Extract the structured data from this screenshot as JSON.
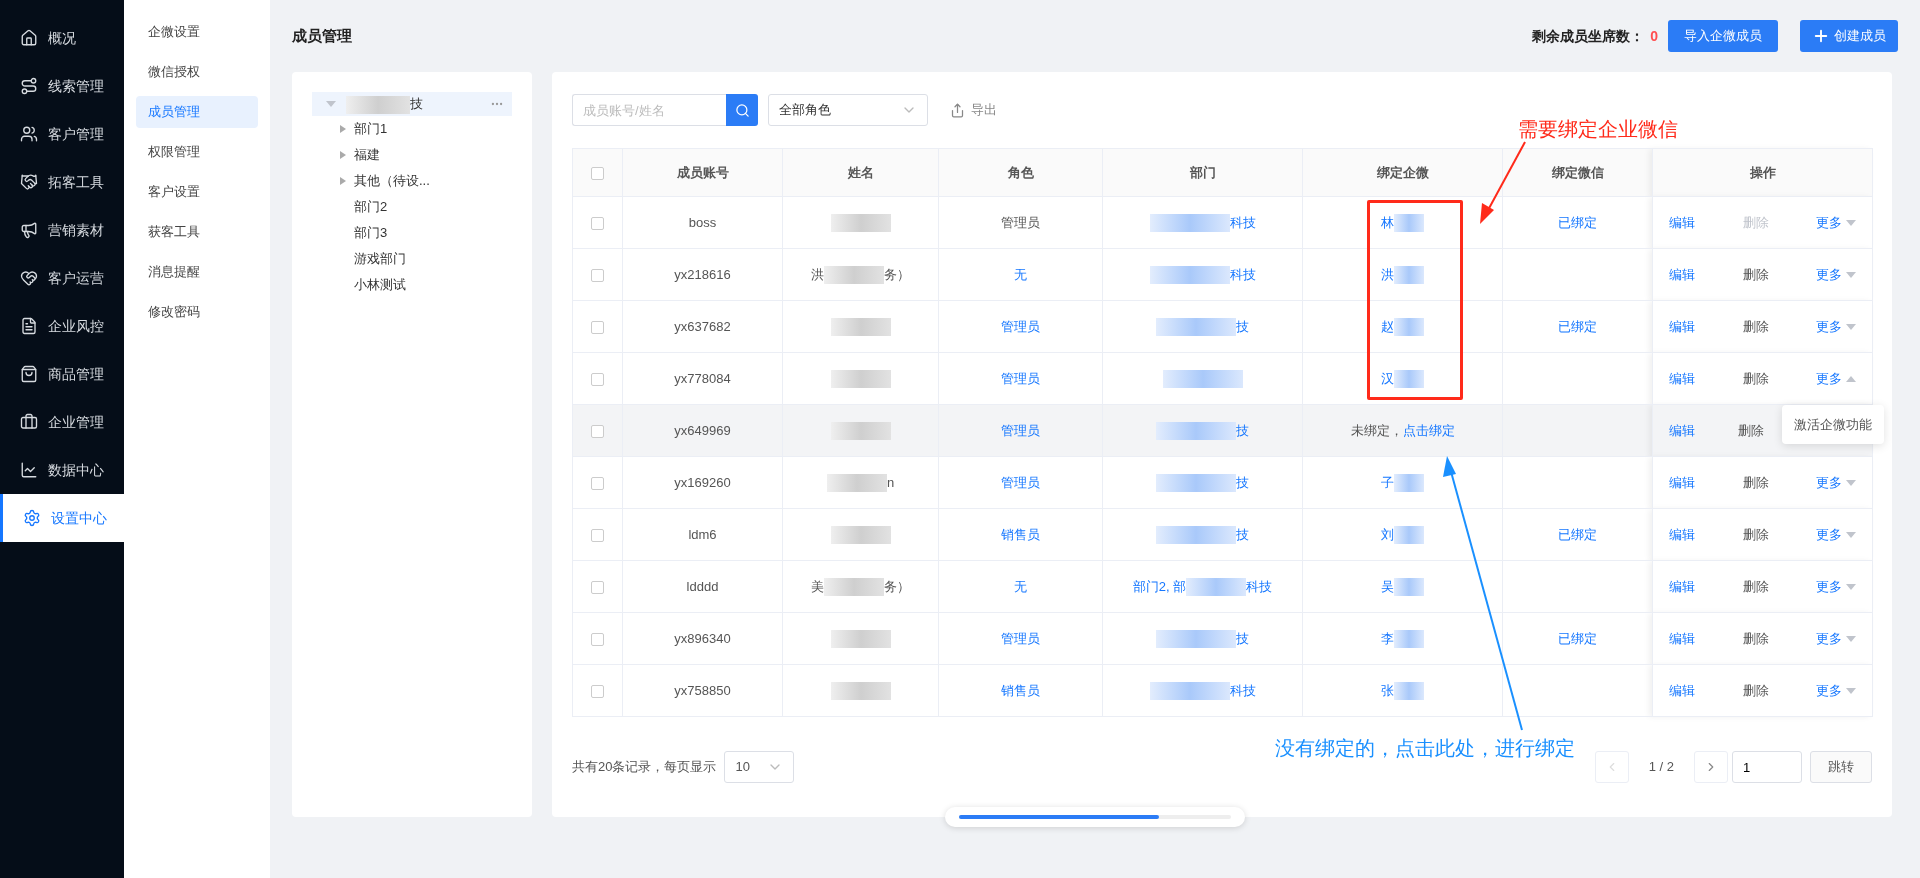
{
  "sidebar": {
    "items": [
      {
        "label": "概况",
        "selected": false
      },
      {
        "label": "线索管理",
        "selected": false
      },
      {
        "label": "客户管理",
        "selected": false
      },
      {
        "label": "拓客工具",
        "selected": false
      },
      {
        "label": "营销素材",
        "selected": false
      },
      {
        "label": "客户运营",
        "selected": false
      },
      {
        "label": "企业风控",
        "selected": false
      },
      {
        "label": "商品管理",
        "selected": false
      },
      {
        "label": "企业管理",
        "selected": false
      },
      {
        "label": "数据中心",
        "selected": false
      },
      {
        "label": "设置中心",
        "selected": true
      }
    ]
  },
  "submenu": {
    "items": [
      {
        "label": "企微设置",
        "selected": false
      },
      {
        "label": "微信授权",
        "selected": false
      },
      {
        "label": "成员管理",
        "selected": true
      },
      {
        "label": "权限管理",
        "selected": false
      },
      {
        "label": "客户设置",
        "selected": false
      },
      {
        "label": "获客工具",
        "selected": false
      },
      {
        "label": "消息提醒",
        "selected": false
      },
      {
        "label": "修改密码",
        "selected": false
      }
    ]
  },
  "page": {
    "title": "成员管理",
    "seats_label": "剩余成员坐席数：",
    "seats_value": "0",
    "import_button": "导入企微成员",
    "create_button": "创建成员"
  },
  "tree": {
    "root": {
      "label": "技",
      "expanded": true,
      "selected": true,
      "children": [
        {
          "label": "部门1",
          "expandable": true
        },
        {
          "label": "福建",
          "expandable": true
        },
        {
          "label": "其他（待设...",
          "expandable": true
        },
        {
          "label": "部门2",
          "expandable": false
        },
        {
          "label": "部门3",
          "expandable": false
        },
        {
          "label": "游戏部门",
          "expandable": false
        },
        {
          "label": "小林测试",
          "expandable": false
        }
      ]
    }
  },
  "toolbar": {
    "search": {
      "placeholder": "成员账号/姓名"
    },
    "role_select": "全部角色",
    "export": "导出"
  },
  "table": {
    "select_all_checked": false,
    "columns": [
      "成员账号",
      "姓名",
      "角色",
      "部门",
      "绑定企微",
      "绑定微信",
      "操作"
    ],
    "rows": [
      {
        "checked": false,
        "highlighted": false,
        "account": "boss",
        "name": {},
        "role": {
          "text": "管理员",
          "kind": "plain"
        },
        "dept": {
          "end": "科技"
        },
        "wecom": {
          "kind": "bound",
          "text": "林"
        },
        "wechat": "已绑定",
        "edit": "编辑",
        "delete": {
          "label": "删除",
          "disabled": true
        },
        "more": {
          "label": "更多",
          "expanded": false
        }
      },
      {
        "checked": false,
        "highlighted": false,
        "account": "yx218616",
        "name": {
          "start": "洪",
          "end": "务）"
        },
        "role": {
          "text": "无",
          "kind": "link"
        },
        "dept": {
          "end": "科技"
        },
        "wecom": {
          "kind": "bound",
          "text": "洪"
        },
        "edit": "编辑",
        "delete": {
          "label": "删除",
          "disabled": false
        },
        "more": {
          "label": "更多",
          "expanded": false
        }
      },
      {
        "checked": false,
        "highlighted": false,
        "account": "yx637682",
        "name": {},
        "role": {
          "text": "管理员",
          "kind": "link"
        },
        "dept": {
          "end": "技"
        },
        "wecom": {
          "kind": "bound",
          "text": "赵"
        },
        "wechat": "已绑定",
        "edit": "编辑",
        "delete": {
          "label": "删除",
          "disabled": false
        },
        "more": {
          "label": "更多",
          "expanded": false
        }
      },
      {
        "checked": false,
        "highlighted": false,
        "account": "yx778084",
        "name": {},
        "role": {
          "text": "管理员",
          "kind": "link"
        },
        "dept": {},
        "wecom": {
          "kind": "bound",
          "text": "汉"
        },
        "edit": "编辑",
        "delete": {
          "label": "删除",
          "disabled": false
        },
        "more": {
          "label": "更多",
          "expanded": true,
          "menu": [
            "激活企微功能"
          ]
        }
      },
      {
        "checked": false,
        "highlighted": true,
        "account": "yx649969",
        "name": {},
        "role": {
          "text": "管理员",
          "kind": "link"
        },
        "dept": {
          "end": "技"
        },
        "wecom": {
          "kind": "unbound",
          "text": "未绑定，",
          "link": "点击绑定"
        },
        "edit": "编辑",
        "delete": {
          "label": "删除",
          "disabled": false
        }
      },
      {
        "checked": false,
        "highlighted": false,
        "account": "yx169260",
        "name": {
          "end": "n"
        },
        "role": {
          "text": "管理员",
          "kind": "link"
        },
        "dept": {
          "end": "技"
        },
        "wecom": {
          "kind": "bound",
          "text": "子"
        },
        "edit": "编辑",
        "delete": {
          "label": "删除",
          "disabled": false
        },
        "more": {
          "label": "更多",
          "expanded": false
        }
      },
      {
        "checked": false,
        "highlighted": false,
        "account": "ldm6",
        "name": {},
        "role": {
          "text": "销售员",
          "kind": "link"
        },
        "dept": {
          "end": "技"
        },
        "wecom": {
          "kind": "bound",
          "text": "刘"
        },
        "wechat": "已绑定",
        "edit": "编辑",
        "delete": {
          "label": "删除",
          "disabled": false
        },
        "more": {
          "label": "更多",
          "expanded": false
        }
      },
      {
        "checked": false,
        "highlighted": false,
        "account": "ldddd",
        "name": {
          "start": "美",
          "end": "务）"
        },
        "role": {
          "text": "无",
          "kind": "link"
        },
        "dept": {
          "start": "部门2, 部",
          "end": "科技"
        },
        "wecom": {
          "kind": "bound",
          "text": "吴"
        },
        "edit": "编辑",
        "delete": {
          "label": "删除",
          "disabled": false
        },
        "more": {
          "label": "更多",
          "expanded": false
        }
      },
      {
        "checked": false,
        "highlighted": false,
        "account": "yx896340",
        "name": {},
        "role": {
          "text": "管理员",
          "kind": "link"
        },
        "dept": {
          "end": "技"
        },
        "wecom": {
          "kind": "bound",
          "text": "李"
        },
        "wechat": "已绑定",
        "edit": "编辑",
        "delete": {
          "label": "删除",
          "disabled": false
        },
        "more": {
          "label": "更多",
          "expanded": false
        }
      },
      {
        "checked": false,
        "highlighted": false,
        "account": "yx758850",
        "name": {},
        "role": {
          "text": "销售员",
          "kind": "link"
        },
        "dept": {
          "end": "科技"
        },
        "wecom": {
          "kind": "bound",
          "text": "张"
        },
        "edit": "编辑",
        "delete": {
          "label": "删除",
          "disabled": false
        },
        "more": {
          "label": "更多",
          "expanded": false
        }
      }
    ]
  },
  "pagination": {
    "summary": "共有20条记录，每页显示",
    "page_size": "10",
    "page": "1 / 2",
    "prev_disabled": true,
    "next_disabled": false,
    "jump_value": "1",
    "jump_button": "跳转"
  },
  "annotations": [
    {
      "text": "需要绑定企业微信",
      "color": "#ff2a1a"
    },
    {
      "text": "没有绑定的，点击此处，进行绑定",
      "color": "#1a90ff"
    }
  ]
}
